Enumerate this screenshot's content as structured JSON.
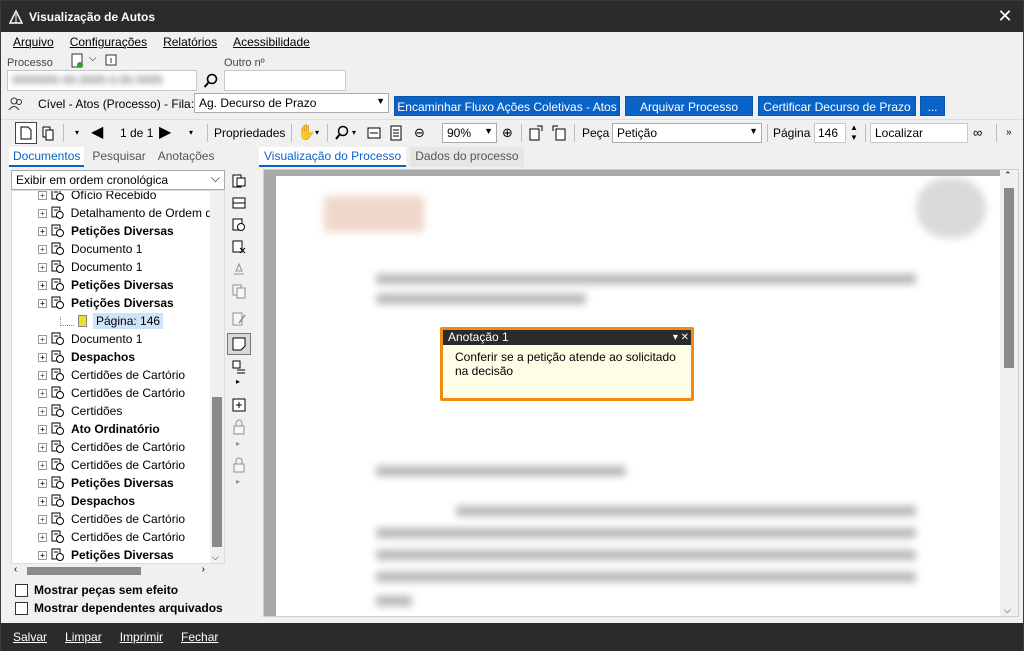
{
  "window": {
    "title": "Visualização de Autos"
  },
  "menu": [
    "Arquivo",
    "Configurações",
    "Relatórios",
    "Acessibilidade"
  ],
  "processo": {
    "label": "Processo",
    "value": "0000000-00.0000.0.00.0000",
    "outro_label": "Outro nº",
    "outro_value": ""
  },
  "fila": {
    "label": "Cível - Atos (Processo) - Fila:",
    "value": "Ag. Decurso de Prazo"
  },
  "actions": [
    "Encaminhar Fluxo Ações Coletivas - Atos",
    "Arquivar Processo",
    "Certificar Decurso de Prazo",
    "..."
  ],
  "toolbar": {
    "page_count": "1 de 1",
    "properties": "Propriedades",
    "zoom": "90%",
    "peca_label": "Peça",
    "peca_value": "Petição",
    "pagina_label": "Página",
    "pagina_value": "146",
    "localizar": "Localizar"
  },
  "left_tabs": [
    "Documentos",
    "Pesquisar",
    "Anotações"
  ],
  "tree_filter": "Exibir em ordem cronológica",
  "tree": [
    {
      "label": "Ofício Recebido",
      "bold": false
    },
    {
      "label": "Detalhamento de Ordem d",
      "bold": false
    },
    {
      "label": "Petições Diversas",
      "bold": true
    },
    {
      "label": "Documento 1",
      "bold": false
    },
    {
      "label": "Documento 1",
      "bold": false
    },
    {
      "label": "Petições Diversas",
      "bold": true
    },
    {
      "label": "Petições Diversas",
      "bold": true
    },
    {
      "label": "Página: 146",
      "bold": false,
      "child": true
    },
    {
      "label": "Documento 1",
      "bold": false
    },
    {
      "label": "Despachos",
      "bold": true
    },
    {
      "label": "Certidões de Cartório",
      "bold": false
    },
    {
      "label": "Certidões de Cartório",
      "bold": false
    },
    {
      "label": "Certidões",
      "bold": false
    },
    {
      "label": "Ato Ordinatório",
      "bold": true
    },
    {
      "label": "Certidões de Cartório",
      "bold": false
    },
    {
      "label": "Certidões de Cartório",
      "bold": false
    },
    {
      "label": "Petições Diversas",
      "bold": true
    },
    {
      "label": "Despachos",
      "bold": true
    },
    {
      "label": "Certidões de Cartório",
      "bold": false
    },
    {
      "label": "Certidões de Cartório",
      "bold": false
    },
    {
      "label": "Petições Diversas",
      "bold": true
    }
  ],
  "checks": [
    "Mostrar peças sem efeito",
    "Mostrar dependentes arquivados"
  ],
  "right_tabs": [
    "Visualização do Processo",
    "Dados do processo"
  ],
  "annotation": {
    "title": "Anotação 1",
    "text": "Conferir se a petição atende ao solicitado na decisão"
  },
  "status": [
    "Salvar",
    "Limpar",
    "Imprimir",
    "Fechar"
  ],
  "colors": {
    "accent": "#0a64c8",
    "annotation_border": "#f08a10",
    "titlebar": "#2b2b2b"
  }
}
